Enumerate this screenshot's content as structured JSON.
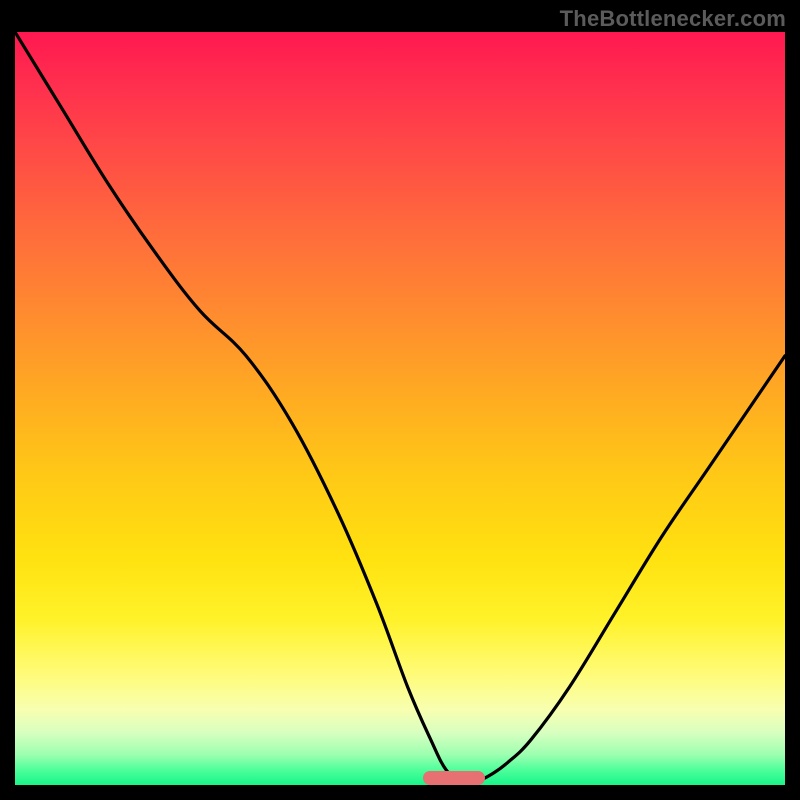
{
  "watermark": "TheBottlenecker.com",
  "chart_data": {
    "type": "line",
    "title": "",
    "xlabel": "",
    "ylabel": "",
    "xlim": [
      0,
      100
    ],
    "ylim": [
      0,
      100
    ],
    "x": [
      0,
      6,
      12,
      18,
      24,
      30,
      36,
      42,
      47,
      51,
      54,
      56,
      58,
      60,
      62,
      64,
      67,
      72,
      78,
      84,
      90,
      96,
      100
    ],
    "values": [
      100,
      90,
      80,
      71,
      63,
      57,
      48,
      36,
      24,
      13,
      6,
      2,
      0.5,
      0.5,
      1.5,
      3,
      6,
      13,
      23,
      33,
      42,
      51,
      57
    ],
    "marker": {
      "x_center": 57,
      "y": 0.5,
      "width_pct": 8
    },
    "background_gradient_stops": [
      {
        "pos": 0,
        "color": "#ff1850"
      },
      {
        "pos": 50,
        "color": "#ffaa22"
      },
      {
        "pos": 80,
        "color": "#fff22a"
      },
      {
        "pos": 100,
        "color": "#18f58a"
      }
    ],
    "note": "Values estimated from gridless figure; x is horizontal percent, values is vertical percent (0 = bottom)."
  }
}
